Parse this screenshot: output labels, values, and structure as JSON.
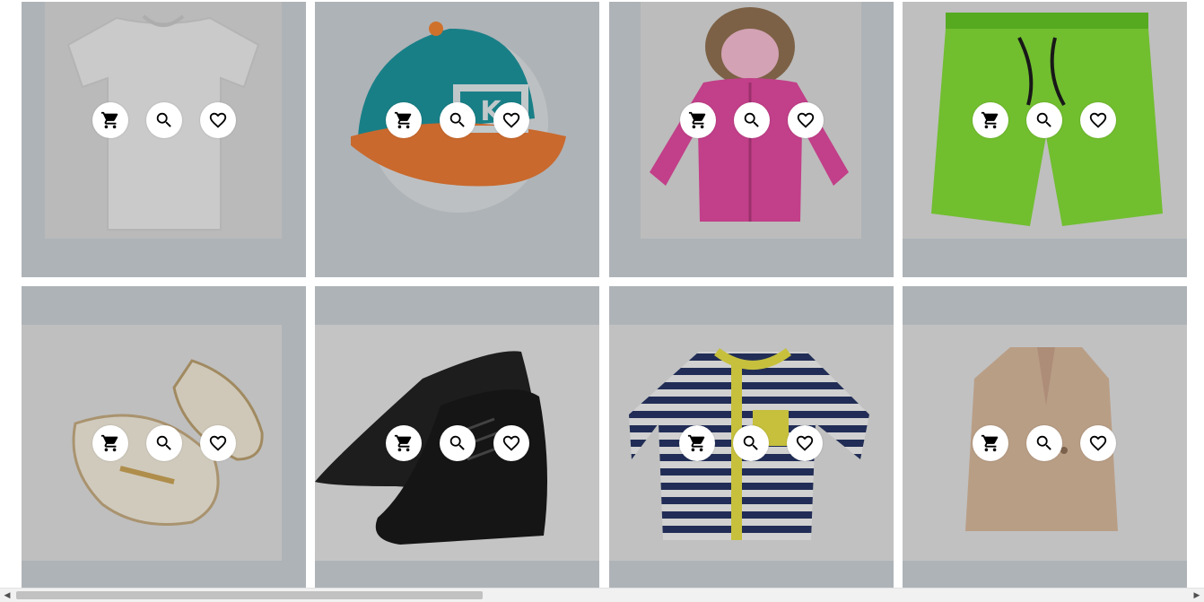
{
  "products": [
    {
      "name": "white-tshirt",
      "bg": "#c9cbce",
      "item": "tshirt"
    },
    {
      "name": "teal-cap",
      "bg": "#c7cdd2",
      "item": "cap"
    },
    {
      "name": "pink-jacket",
      "bg": "#c8c8ca",
      "item": "jacket"
    },
    {
      "name": "green-shorts",
      "bg": "#c6c6c8",
      "item": "shorts"
    },
    {
      "name": "cream-flats",
      "bg": "#c7cdd2",
      "item": "flats"
    },
    {
      "name": "black-oxfords",
      "bg": "#c8cacc",
      "item": "oxfords"
    },
    {
      "name": "striped-shirt",
      "bg": "#cacbcd",
      "item": "striped"
    },
    {
      "name": "beige-blazer",
      "bg": "#c8c9cb",
      "item": "blazer"
    }
  ],
  "actions": [
    {
      "name": "add-to-cart",
      "icon": "cart-icon"
    },
    {
      "name": "quick-view",
      "icon": "search-icon"
    },
    {
      "name": "wishlist",
      "icon": "heart-icon"
    }
  ],
  "colors": {
    "card_bg": "#c7cdd2",
    "gap": "#ffffff",
    "button": "#ffffff",
    "icon": "#000000"
  }
}
